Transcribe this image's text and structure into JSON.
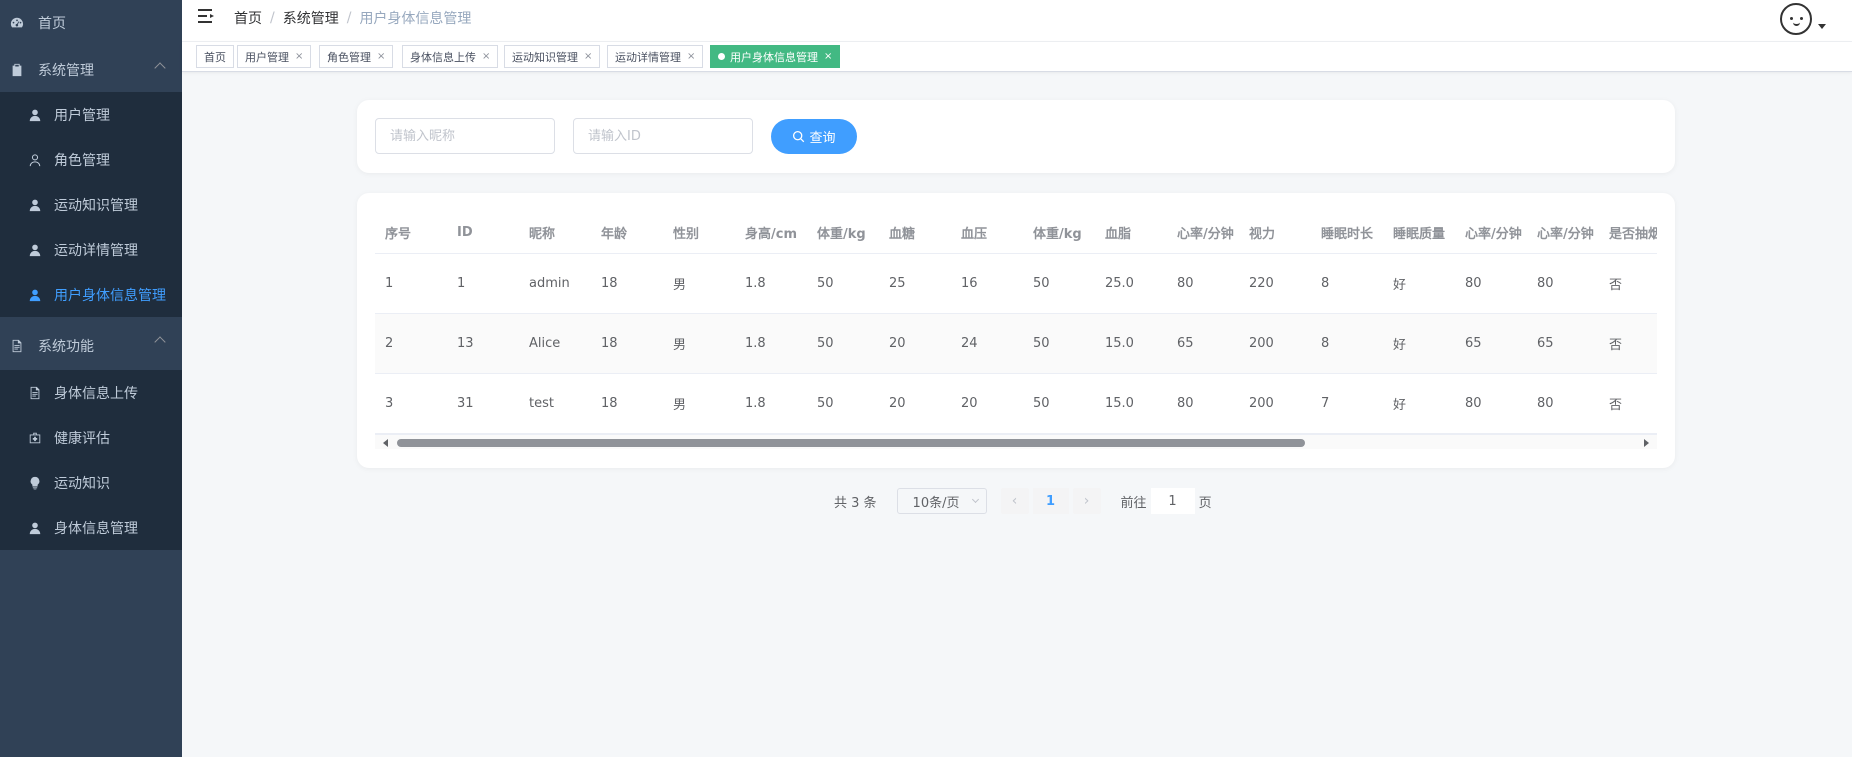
{
  "sidebar": {
    "home": "首页",
    "system": "系统管理",
    "system_items": [
      "用户管理",
      "角色管理",
      "运动知识管理",
      "运动详情管理",
      "用户身体信息管理"
    ],
    "functions": "系统功能",
    "function_items": [
      "身体信息上传",
      "健康评估",
      "运动知识",
      "身体信息管理"
    ]
  },
  "header": {
    "breadcrumb": [
      "首页",
      "系统管理",
      "用户身体信息管理"
    ]
  },
  "tags": [
    {
      "label": "首页",
      "closable": false
    },
    {
      "label": "用户管理",
      "closable": true
    },
    {
      "label": "角色管理",
      "closable": true
    },
    {
      "label": "身体信息上传",
      "closable": true
    },
    {
      "label": "运动知识管理",
      "closable": true
    },
    {
      "label": "运动详情管理",
      "closable": true
    },
    {
      "label": "用户身体信息管理",
      "closable": true,
      "active": true
    }
  ],
  "search": {
    "nickname_placeholder": "请输入昵称",
    "id_placeholder": "请输入ID",
    "button": "查询"
  },
  "table": {
    "columns": [
      "序号",
      "ID",
      "昵称",
      "年龄",
      "性别",
      "身高/cm",
      "体重/kg",
      "血糖",
      "血压",
      "体重/kg",
      "血脂",
      "心率/分钟",
      "视力",
      "睡眠时长",
      "睡眠质量",
      "心率/分钟",
      "心率/分钟",
      "是否抽烟"
    ],
    "rows": [
      [
        "1",
        "1",
        "admin",
        "18",
        "男",
        "1.8",
        "50",
        "25",
        "16",
        "50",
        "25.0",
        "80",
        "220",
        "8",
        "好",
        "80",
        "80",
        "否"
      ],
      [
        "2",
        "13",
        "Alice",
        "18",
        "男",
        "1.8",
        "50",
        "20",
        "24",
        "50",
        "15.0",
        "65",
        "200",
        "8",
        "好",
        "65",
        "65",
        "否"
      ],
      [
        "3",
        "31",
        "test",
        "18",
        "男",
        "1.8",
        "50",
        "20",
        "20",
        "50",
        "15.0",
        "80",
        "200",
        "7",
        "好",
        "80",
        "80",
        "否"
      ]
    ]
  },
  "pagination": {
    "total": "共 3 条",
    "page_size": "10条/页",
    "current_page": "1",
    "goto_label": "前往",
    "goto_value": "1",
    "page_suffix": "页"
  },
  "colors": {
    "sidebar_bg": "#304156",
    "submenu_bg": "#1f2d3d",
    "active_menu": "#409eff",
    "active_tag": "#42b983",
    "primary": "#409eff"
  }
}
